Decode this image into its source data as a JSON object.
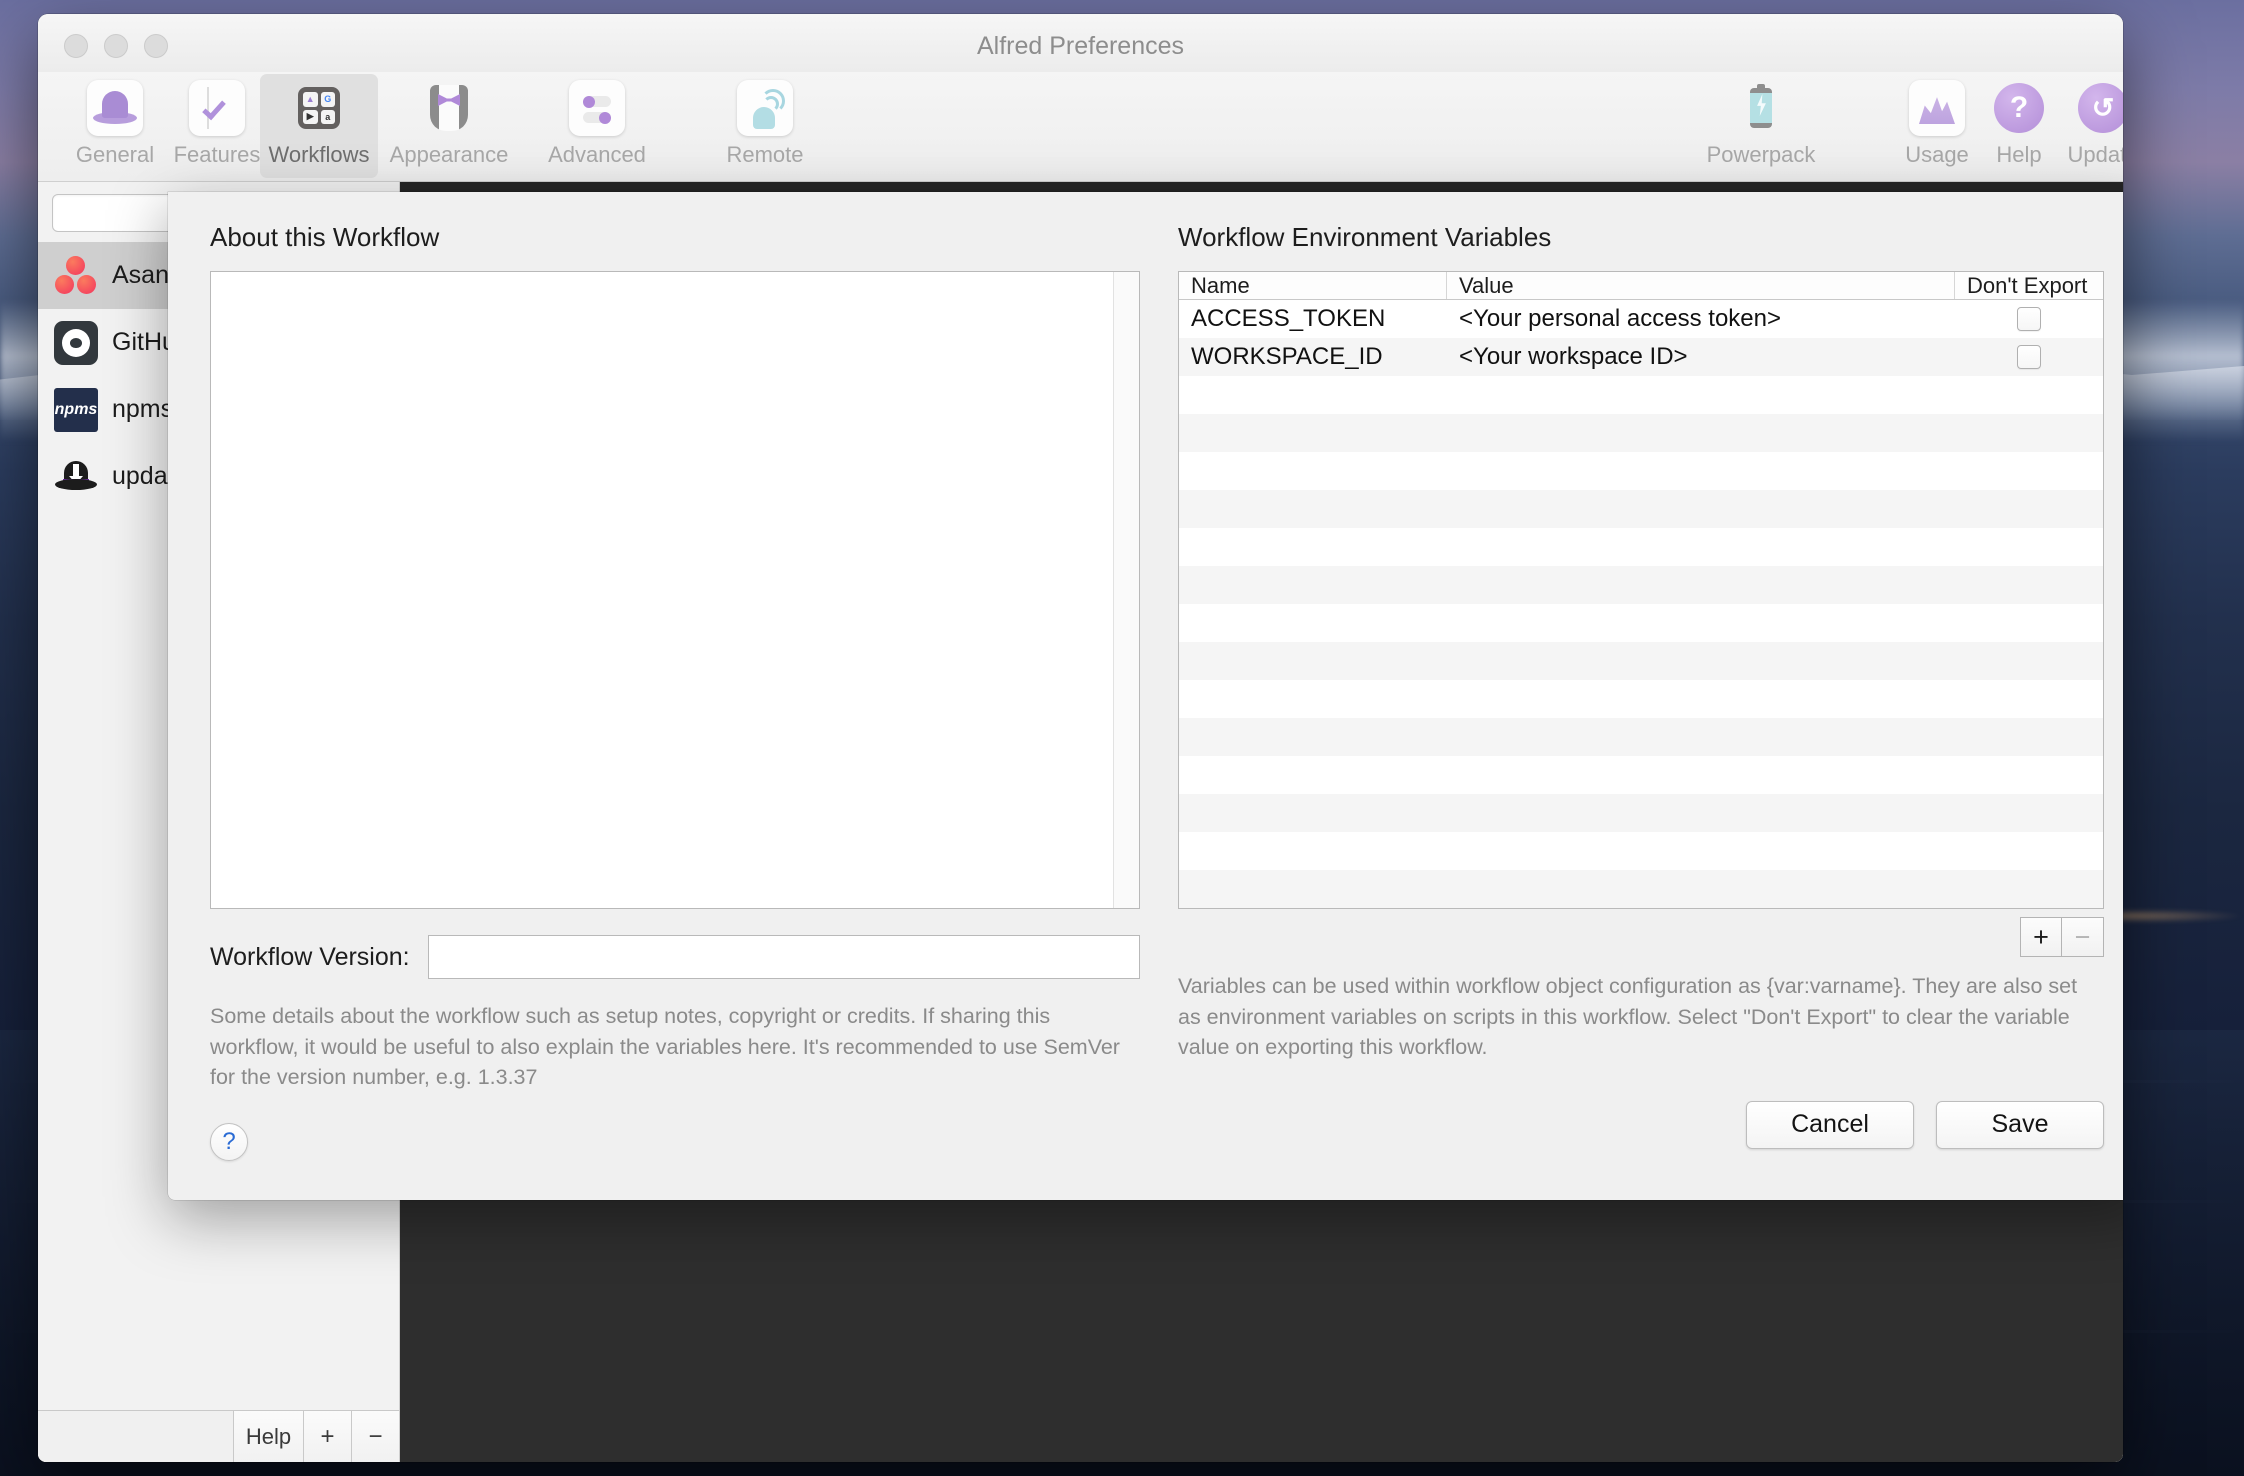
{
  "window": {
    "title": "Alfred Preferences",
    "traffic_lights": [
      "close",
      "minimize",
      "zoom"
    ]
  },
  "toolbar": {
    "items": [
      {
        "label": "General",
        "icon": "alfred-hat-icon",
        "selected": false
      },
      {
        "label": "Features",
        "icon": "checklist-icon",
        "selected": false
      },
      {
        "label": "Workflows",
        "icon": "workflows-grid-icon",
        "selected": true
      },
      {
        "label": "Appearance",
        "icon": "tuxedo-icon",
        "selected": false
      },
      {
        "label": "Advanced",
        "icon": "toggles-icon",
        "selected": false
      },
      {
        "label": "Remote",
        "icon": "remote-signal-icon",
        "selected": false
      },
      {
        "label": "Powerpack",
        "icon": "battery-bolt-icon",
        "selected": false
      },
      {
        "label": "Usage",
        "icon": "usage-chart-icon",
        "selected": false
      },
      {
        "label": "Help",
        "icon": "question-circle-icon",
        "selected": false
      },
      {
        "label": "Update",
        "icon": "refresh-circle-icon",
        "selected": false
      }
    ]
  },
  "sidebar": {
    "search": {
      "value": "",
      "placeholder": ""
    },
    "workflows": [
      {
        "name": "Asana",
        "icon": "asana-icon",
        "selected": true
      },
      {
        "name": "GitHub",
        "icon": "github-icon",
        "selected": false
      },
      {
        "name": "npms",
        "icon": "npms-icon",
        "selected": false
      },
      {
        "name": "update",
        "icon": "update-hat-icon",
        "selected": false
      }
    ],
    "bottom_bar": {
      "help_label": "Help",
      "add_label": "+",
      "remove_label": "−"
    }
  },
  "canvas": {
    "debug_icon": "bug-icon"
  },
  "sheet": {
    "left": {
      "section_title": "About this Workflow",
      "about_text": "",
      "version_label": "Workflow Version:",
      "version_value": "",
      "help_text": "Some details about the workflow such as setup notes, copyright or credits. If sharing this workflow, it would be useful to also explain the variables here. It's recommended to use SemVer for the version number, e.g. 1.3.37",
      "help_button_label": "?"
    },
    "right": {
      "section_title": "Workflow Environment Variables",
      "columns": [
        "Name",
        "Value",
        "Don't Export"
      ],
      "rows": [
        {
          "name": "ACCESS_TOKEN",
          "value": "<Your personal access token>",
          "dont_export": false
        },
        {
          "name": "WORKSPACE_ID",
          "value": "<Your workspace ID>",
          "dont_export": false
        }
      ],
      "empty_row_count": 14,
      "add_label": "+",
      "remove_label": "−",
      "help_text": "Variables can be used within workflow object configuration as {var:varname}. They are also set as environment variables on scripts in this workflow. Select \"Don't Export\" to clear the variable value on exporting this workflow.",
      "cancel_label": "Cancel",
      "save_label": "Save"
    }
  },
  "colors": {
    "accent": "#b089d8",
    "window_bg": "#ececec",
    "sheet_bg": "#f0f0f0",
    "canvas_dark": "#2e2e2e",
    "row_stripe": "#f5f5f5",
    "muted_text": "#8a8a8a"
  }
}
